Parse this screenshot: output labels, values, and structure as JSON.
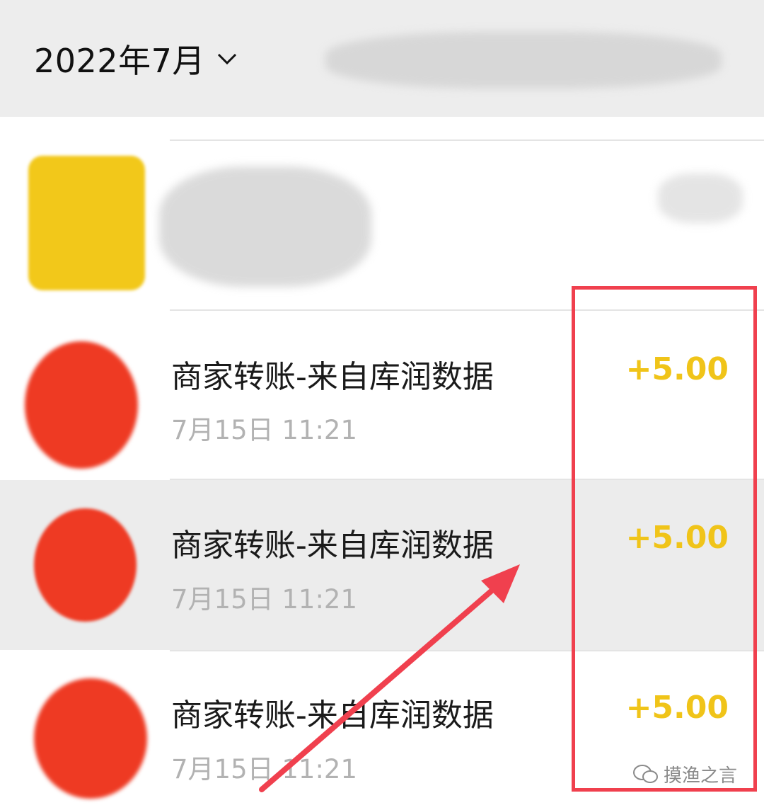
{
  "header": {
    "month": "2022年7月"
  },
  "transactions": [
    {
      "title": "商家转账-来自库润数据",
      "time": "7月15日 11:21",
      "amount": "+5.00"
    },
    {
      "title": "商家转账-来自库润数据",
      "time": "7月15日 11:21",
      "amount": "+5.00"
    },
    {
      "title": "商家转账-来自库润数据",
      "time": "7月15日 11:21",
      "amount": "+5.00"
    }
  ],
  "watermark": {
    "text": "摸渔之言"
  },
  "colors": {
    "amount": "#f0c419",
    "annotation": "#f0404e",
    "header_bg": "#ededed"
  }
}
